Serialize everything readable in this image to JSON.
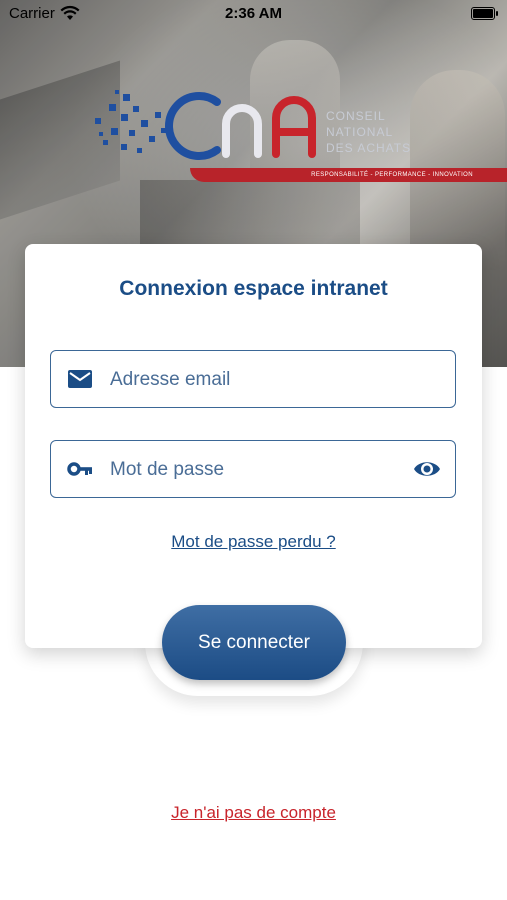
{
  "status_bar": {
    "carrier": "Carrier",
    "time": "2:36 AM"
  },
  "logo": {
    "brand_letters": "CnA",
    "name_lines": [
      "CONSEIL",
      "NATIONAL",
      "DES ACHATS"
    ],
    "tagline": "RESPONSABILITÉ  -  PERFORMANCE  -  INNOVATION",
    "colors": {
      "blue": "#1f4fa0",
      "red": "#c8242b"
    }
  },
  "login_card": {
    "title": "Connexion espace intranet",
    "email_field": {
      "placeholder": "Adresse email",
      "value": "",
      "icon": "envelope-icon"
    },
    "password_field": {
      "placeholder": "Mot de passe",
      "value": "",
      "icon": "key-icon",
      "toggle_icon": "eye-icon"
    },
    "forgot_link": "Mot de passe perdu ?",
    "submit_label": "Se connecter"
  },
  "signup_link": "Je n'ai pas de compte",
  "theme": {
    "primary": "#1b4d86",
    "accent_red": "#c8242b",
    "background": "#ffffff"
  }
}
